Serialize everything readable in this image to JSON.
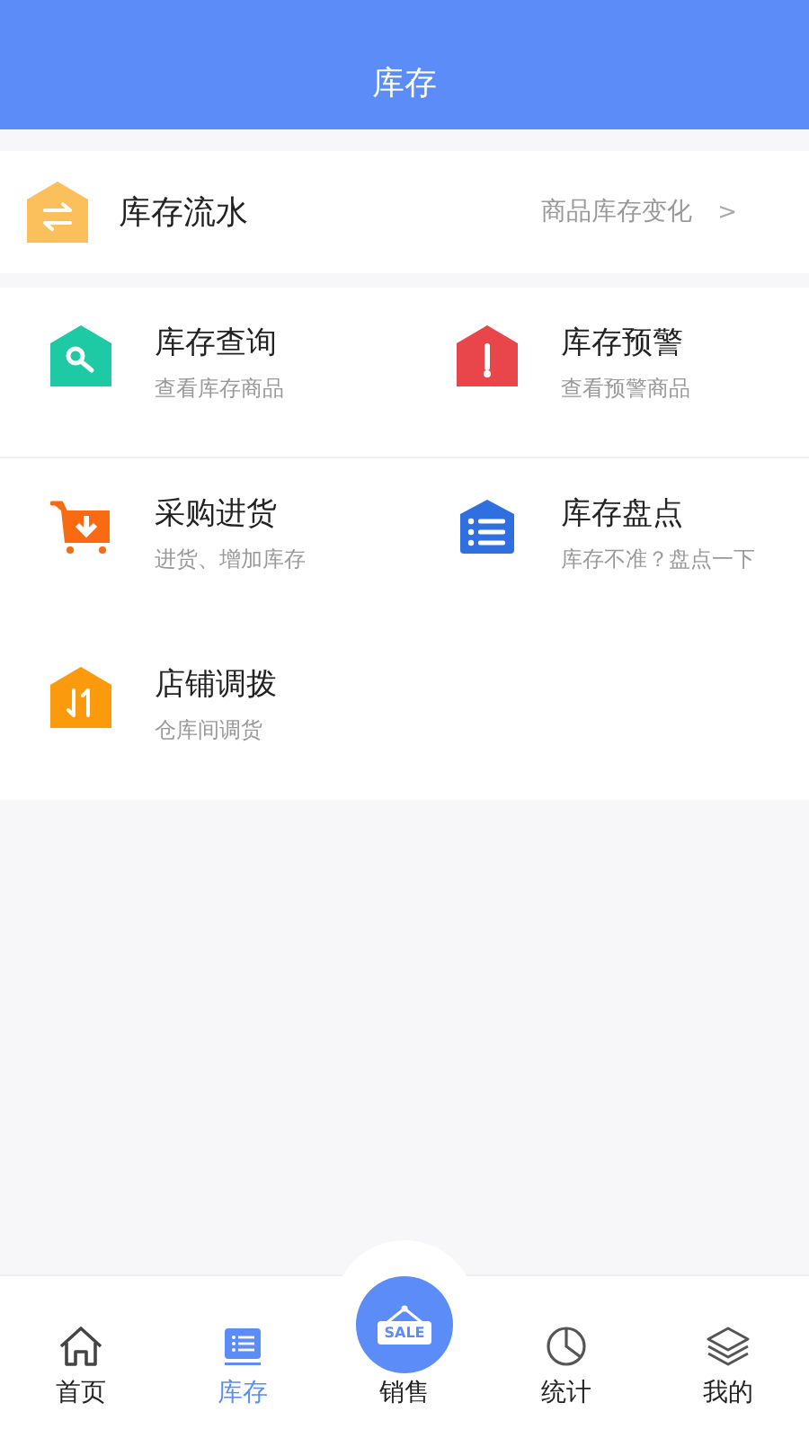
{
  "header": {
    "title": "库存"
  },
  "flow": {
    "kind": "transfer",
    "color": "#fbbf5c",
    "title": "库存流水",
    "hint": "商品库存变化",
    "arrow": ">"
  },
  "features": [
    {
      "kind": "search",
      "color": "#1ecaa3",
      "title": "库存查询",
      "subtitle": "查看库存商品"
    },
    {
      "kind": "alert",
      "color": "#e8464a",
      "title": "库存预警",
      "subtitle": "查看预警商品"
    },
    {
      "kind": "cart",
      "color": "#fa6a12",
      "title": "采购进货",
      "subtitle": "进货、增加库存"
    },
    {
      "kind": "list",
      "color": "#2f6fe0",
      "title": "库存盘点",
      "subtitle": "库存不准？盘点一下"
    },
    {
      "kind": "transfer",
      "color": "#fb9a0c",
      "title": "店铺调拨",
      "subtitle": "仓库间调货"
    }
  ],
  "tabbar": [
    {
      "kind": "home",
      "label": "首页",
      "selected": false
    },
    {
      "kind": "list",
      "label": "库存",
      "selected": true
    },
    {
      "kind": "sale",
      "label": "销售",
      "sign": "SALE",
      "selected": false
    },
    {
      "kind": "chart",
      "label": "统计",
      "selected": false
    },
    {
      "kind": "layers",
      "label": "我的",
      "selected": false
    }
  ]
}
